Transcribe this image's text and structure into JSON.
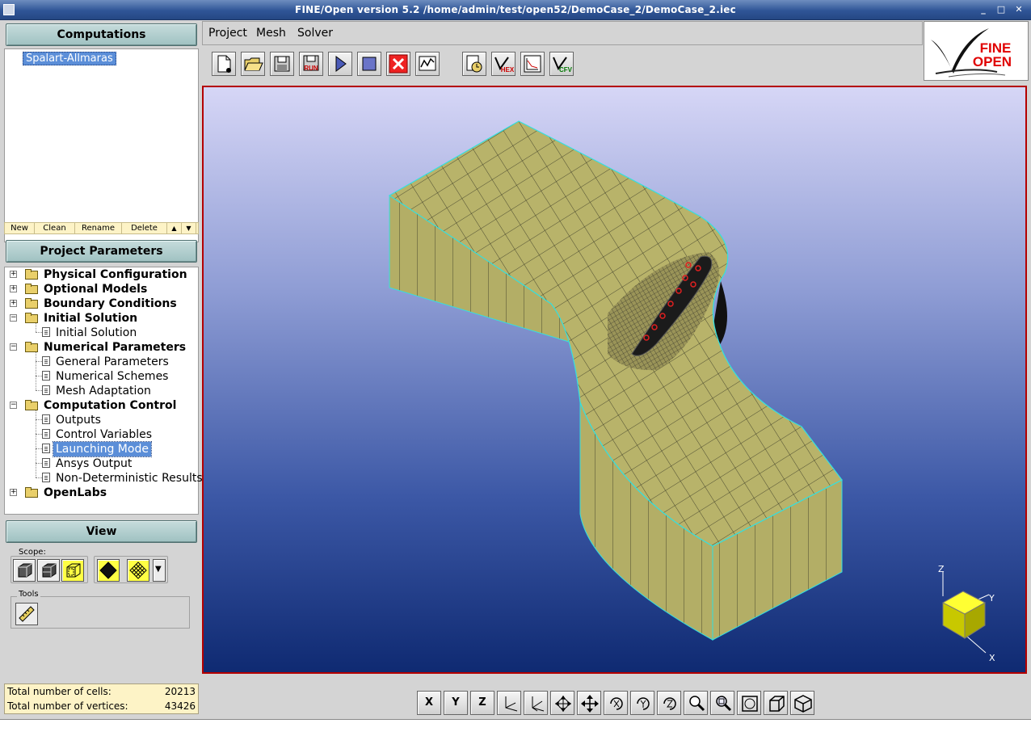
{
  "window": {
    "title": "FINE/Open version 5.2     /home/admin/test/open52/DemoCase_2/DemoCase_2.iec",
    "controls": [
      "_",
      "□",
      "✕"
    ]
  },
  "computations": {
    "header": "Computations",
    "items": [
      "Spalart-Allmaras"
    ],
    "buttons": {
      "new": "New",
      "clean": "Clean",
      "rename": "Rename",
      "delete": "Delete",
      "up": "▲",
      "down": "▼"
    }
  },
  "project_parameters": {
    "header": "Project Parameters",
    "tree": {
      "physical_configuration": "Physical Configuration",
      "optional_models": "Optional Models",
      "boundary_conditions": "Boundary Conditions",
      "initial_solution": "Initial Solution",
      "initial_solution_child": "Initial Solution",
      "numerical_parameters": "Numerical Parameters",
      "general_parameters": "General Parameters",
      "numerical_schemes": "Numerical Schemes",
      "mesh_adaptation": "Mesh Adaptation",
      "computation_control": "Computation Control",
      "outputs": "Outputs",
      "control_variables": "Control Variables",
      "launching_mode": "Launching Mode",
      "ansys_output": "Ansys Output",
      "non_deterministic": "Non-Deterministic Results",
      "openlabs": "OpenLabs"
    },
    "expander_plus": "+",
    "expander_minus": "−"
  },
  "view": {
    "header": "View",
    "scope_label": "Scope:",
    "tools_label": "Tools",
    "dropdown_arrow": "▼"
  },
  "stats": {
    "cells_label": "Total number of cells:",
    "cells_value": "20213",
    "vertices_label": "Total number of vertices:",
    "vertices_value": "43426"
  },
  "menu": {
    "project": "Project",
    "mesh": "Mesh",
    "solver": "Solver"
  },
  "logo": {
    "line1": "FINE",
    "line2": "OPEN"
  },
  "toolbar_icon_text": {
    "run": "RUN",
    "hex": "HEX",
    "cfv": "CFV"
  },
  "axes": {
    "z": "Z",
    "y": "Y",
    "x": "X"
  },
  "view_toolbar": {
    "x": "X",
    "y": "Y",
    "z": "Z"
  },
  "colors": {
    "mesh_fill": "#b8b36a",
    "mesh_edge": "#33e0e0",
    "selection": "#5b8ed8",
    "header_button": "#a9c8c8",
    "viewport_border": "#b40000"
  }
}
